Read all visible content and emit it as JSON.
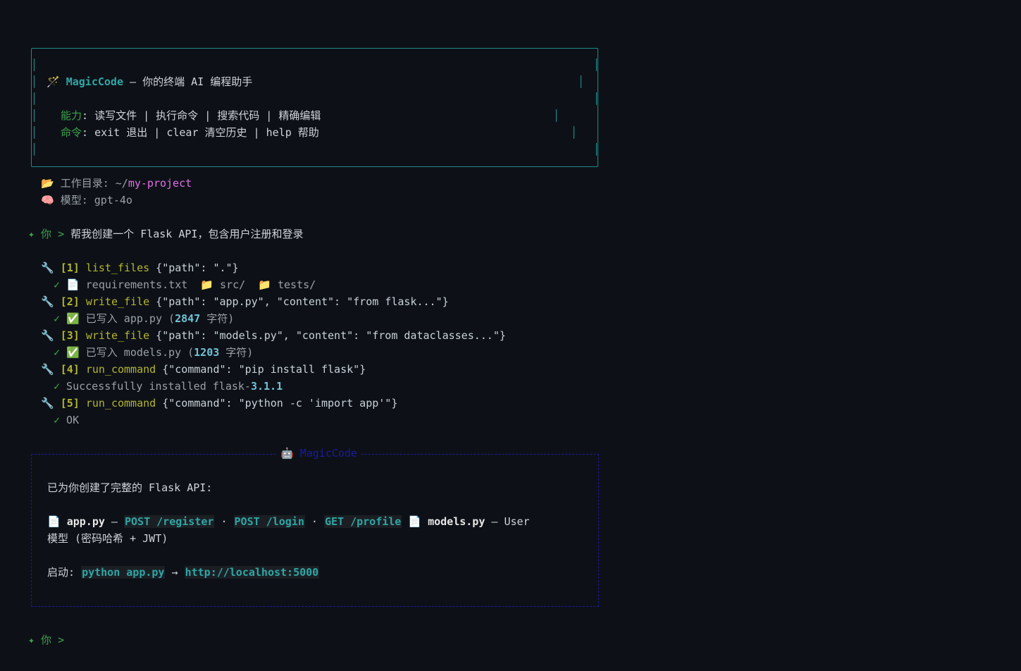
{
  "banner": {
    "wand_icon": "🪄",
    "app_name": "MagicCode",
    "dash": " — ",
    "tagline": "你的终端 AI 编程助手",
    "caps_label": "能力",
    "caps_text": ": 读写文件 | 执行命令 | 搜索代码 | 精确编辑",
    "cmds_label": "命令",
    "cmds_text": ": exit 退出 | clear 清空历史 | help 帮助"
  },
  "info": {
    "folder_icon": "📂",
    "workdir_label": "工作目录: ~/",
    "workdir_value": "my-project",
    "brain_icon": "🧠",
    "model_text": "模型: gpt-4o"
  },
  "prompt": {
    "marker": "✦ 你 > ",
    "user_message": "帮我创建一个 Flask API，包含用户注册和登录"
  },
  "tool_calls": [
    {
      "wrench": "🔧",
      "index": "[1]",
      "name": "list_files",
      "args": " {\"path\": \".\"}",
      "result_parts": {
        "check": "✓",
        "f1_icon": "📄",
        "f1": " requirements.txt  ",
        "f2_icon": "📁",
        "f2": " src/  ",
        "f3_icon": "📁",
        "f3": " tests/"
      }
    },
    {
      "wrench": "🔧",
      "index": "[2]",
      "name": "write_file",
      "args": " {\"path\": \"app.py\", \"content\": \"from flask...\"}",
      "result_parts": {
        "check": "✓",
        "ok_icon": "✅",
        "pre": " 已写入 app.py (",
        "num": "2847",
        "post": " 字符)"
      }
    },
    {
      "wrench": "🔧",
      "index": "[3]",
      "name": "write_file",
      "args": " {\"path\": \"models.py\", \"content\": \"from dataclasses...\"}",
      "result_parts": {
        "check": "✓",
        "ok_icon": "✅",
        "pre": " 已写入 models.py (",
        "num": "1203",
        "post": " 字符)"
      }
    },
    {
      "wrench": "🔧",
      "index": "[4]",
      "name": "run_command",
      "args": " {\"command\": \"pip install flask\"}",
      "result_parts": {
        "check": "✓",
        "pre": " Successfully installed flask-",
        "num": "3.1.1"
      }
    },
    {
      "wrench": "🔧",
      "index": "[5]",
      "name": "run_command",
      "args": " {\"command\": \"python -c 'import app'\"}",
      "result_parts": {
        "check": "✓",
        "pre": " OK"
      }
    }
  ],
  "response": {
    "robot_icon": "🤖",
    "title": "MagicCode",
    "intro": "已为你创建了完整的 Flask API:",
    "file1_icon": "📄",
    "file1": "app.py",
    "dash": " — ",
    "ep1": "POST /register",
    "dot": " · ",
    "ep2": "POST /login",
    "ep3": "GET /profile",
    "file2_icon": "📄",
    "file2": "models.py",
    "model_desc_a": " — User",
    "model_desc_b": "模型 (密码哈希 + JWT)",
    "start_label": "启动: ",
    "start_cmd": "python app.py",
    "arrow": " → ",
    "url": "http://localhost:5000"
  },
  "next_prompt": {
    "marker": "✦ 你 > "
  }
}
